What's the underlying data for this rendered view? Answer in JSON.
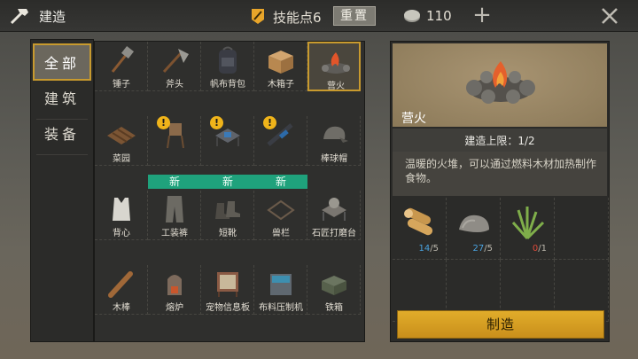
{
  "header": {
    "title": "建造",
    "skill_points": "技能点6",
    "reset_label": "重置",
    "coins": "110",
    "icons": [
      "build-icon",
      "skill-icon",
      "coin-icon",
      "plus-icon",
      "close-icon"
    ]
  },
  "sidebar": {
    "items": [
      {
        "label": "全部",
        "active": true
      },
      {
        "label": "建筑",
        "active": false
      },
      {
        "label": "装备",
        "active": false
      }
    ]
  },
  "grid": {
    "items": [
      {
        "label": "锤子",
        "icon": "hammer-icon"
      },
      {
        "label": "斧头",
        "icon": "axe-icon"
      },
      {
        "label": "帆布背包",
        "icon": "backpack-icon"
      },
      {
        "label": "木箱子",
        "icon": "wooden-box-icon"
      },
      {
        "label": "营火",
        "icon": "campfire-icon",
        "selected": true
      },
      {
        "label": "菜园",
        "icon": "garden-icon"
      },
      {
        "label": "",
        "icon": "water-barrel-icon",
        "warning": true,
        "new": true
      },
      {
        "label": "",
        "icon": "workbench-icon",
        "warning": true,
        "new": true
      },
      {
        "label": "",
        "icon": "gun-icon",
        "warning": true,
        "new": true
      },
      {
        "label": "棒球帽",
        "icon": "cap-icon"
      },
      {
        "label": "背心",
        "icon": "vest-icon"
      },
      {
        "label": "工装裤",
        "icon": "pants-icon"
      },
      {
        "label": "短靴",
        "icon": "boots-icon"
      },
      {
        "label": "兽栏",
        "icon": "animal-pen-icon"
      },
      {
        "label": "石匠打磨台",
        "icon": "grinding-table-icon"
      },
      {
        "label": "木棒",
        "icon": "club-icon"
      },
      {
        "label": "熔炉",
        "icon": "furnace-icon"
      },
      {
        "label": "宠物信息板",
        "icon": "pet-board-icon"
      },
      {
        "label": "布料压制机",
        "icon": "cloth-press-icon"
      },
      {
        "label": "铁箱",
        "icon": "iron-box-icon"
      }
    ],
    "new_label": "新",
    "warning_mark": "!"
  },
  "detail": {
    "name": "营火",
    "limit": "建造上限：1/2",
    "description": "温暖的火堆，可以通过燃料木材加热制作食物。",
    "materials": [
      {
        "icon": "wood-icon",
        "have": "14",
        "need": "/5",
        "color": "#4aa3e0"
      },
      {
        "icon": "stone-icon",
        "have": "27",
        "need": "/5",
        "color": "#4aa3e0"
      },
      {
        "icon": "grass-icon",
        "have": "0",
        "need": "/1",
        "color": "#e04a3a"
      }
    ],
    "craft_label": "制造"
  }
}
